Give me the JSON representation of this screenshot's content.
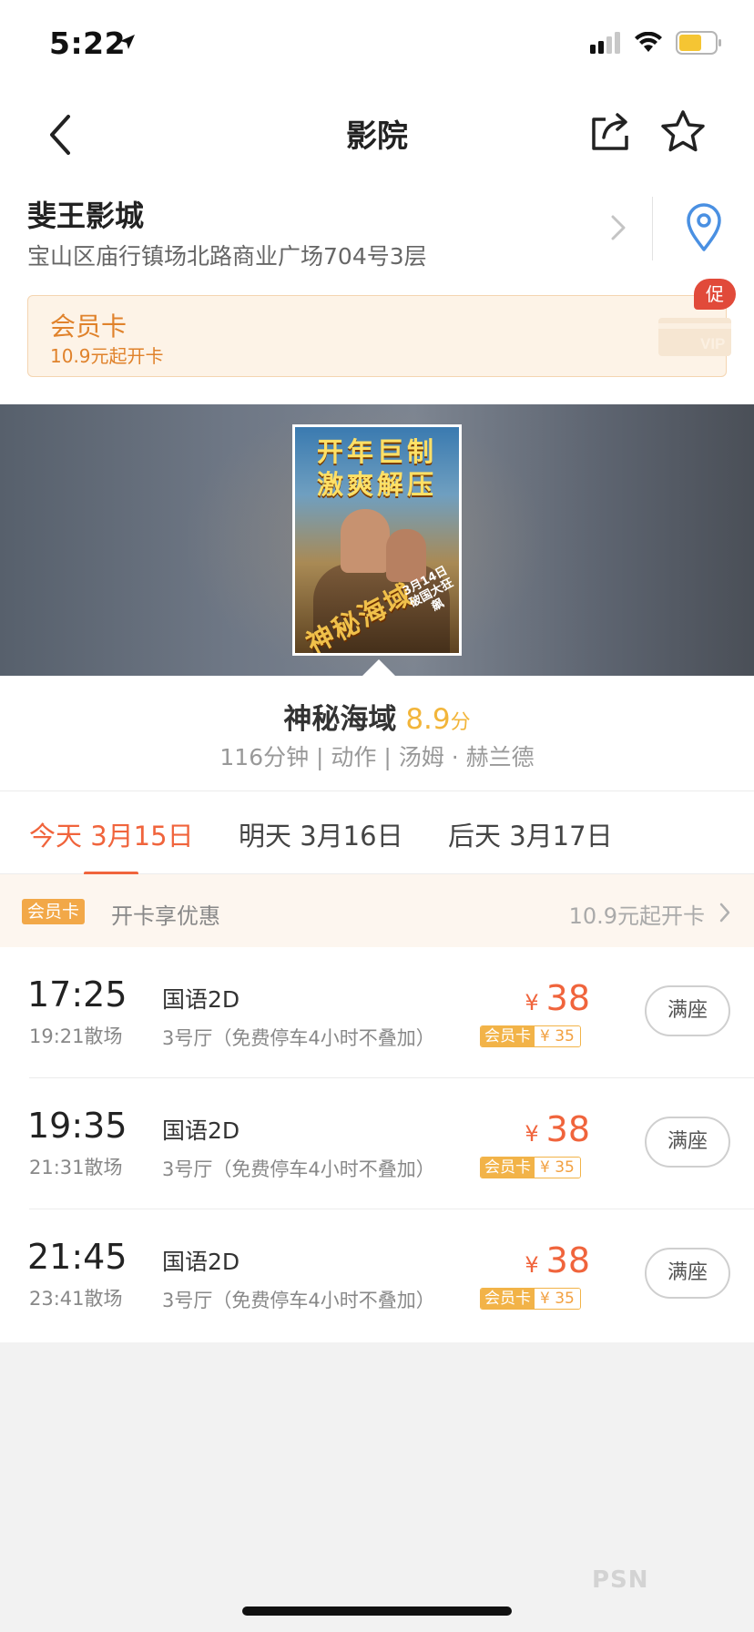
{
  "status_bar": {
    "time": "5:22"
  },
  "nav": {
    "title": "影院"
  },
  "cinema": {
    "name": "斐王影城",
    "address": "宝山区庙行镇场北路商业广场704号3层"
  },
  "member_card": {
    "title": "会员卡",
    "subtitle": "10.9元起开卡",
    "vip_text": "VIP",
    "promo_badge": "促"
  },
  "poster": {
    "headline_line1": "开年巨制",
    "headline_line2": "激爽解压",
    "title_art": "神秘海域",
    "date_line1": "3月14日",
    "date_line2": "破国大狂飙"
  },
  "movie": {
    "title": "神秘海域",
    "score": "8.9",
    "score_unit": "分",
    "meta": "116分钟 | 动作 | 汤姆 · 赫兰德"
  },
  "date_tabs": [
    {
      "label": "今天 3月15日",
      "active": true
    },
    {
      "label": "明天 3月16日",
      "active": false
    },
    {
      "label": "后天 3月17日",
      "active": false
    }
  ],
  "member_strip": {
    "badge": "会员卡",
    "text": "开卡享优惠",
    "right_text": "10.9元起开卡"
  },
  "showtimes": [
    {
      "start": "17:25",
      "end": "19:21散场",
      "lang": "国语2D",
      "hall": "3号厅（免费停车4小时不叠加）",
      "currency": "¥",
      "price": "38",
      "member_label": "会员卡",
      "member_price": "¥ 35",
      "status": "满座"
    },
    {
      "start": "19:35",
      "end": "21:31散场",
      "lang": "国语2D",
      "hall": "3号厅（免费停车4小时不叠加）",
      "currency": "¥",
      "price": "38",
      "member_label": "会员卡",
      "member_price": "¥ 35",
      "status": "满座"
    },
    {
      "start": "21:45",
      "end": "23:41散场",
      "lang": "国语2D",
      "hall": "3号厅（免费停车4小时不叠加）",
      "currency": "¥",
      "price": "38",
      "member_label": "会员卡",
      "member_price": "¥ 35",
      "status": "满座"
    }
  ],
  "watermark": "PSN",
  "colors": {
    "accent": "#f0643c",
    "score": "#f2b53a",
    "member": "#f2b348",
    "member_card_bg": "#fdf3e7",
    "promo": "#e14a3a",
    "location_icon": "#4a90e2"
  },
  "icons": {
    "back": "chevron-left-icon",
    "share": "share-icon",
    "favorite": "star-icon",
    "location": "location-pin-icon",
    "detail": "chevron-right-icon"
  }
}
